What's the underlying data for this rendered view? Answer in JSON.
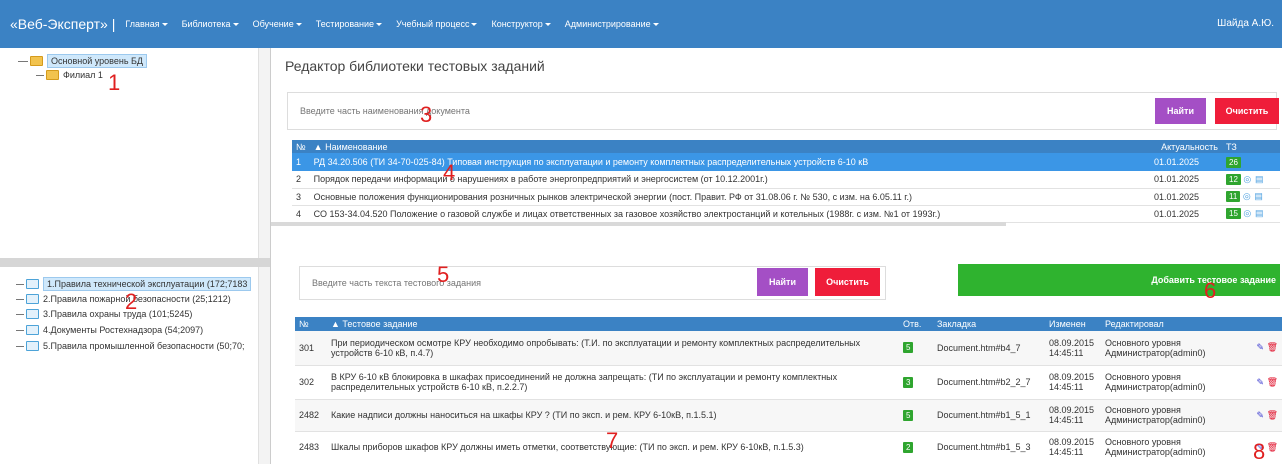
{
  "nav": {
    "brand": "«Веб-Эксперт» |",
    "items": [
      "Главная",
      "Библиотека",
      "Обучение",
      "Тестирование",
      "Учебный процесс",
      "Конструктор",
      "Администрирование"
    ],
    "user": "Шайда А.Ю."
  },
  "tree_top": {
    "root": "Основной уровень БД",
    "child": "Филиал 1"
  },
  "tree_bottom": [
    "1.Правила технической эксплуатации (172;7183",
    "2.Правила пожарной безопасности (25;1212)",
    "3.Правила охраны труда (101;5245)",
    "4.Документы Ростехнадзора (54;2097)",
    "5.Правила промышленной безопасности (50;70;"
  ],
  "main": {
    "title": "Редактор библиотеки тестовых заданий",
    "doc_search_placeholder": "Введите часть наименования документа",
    "find_label": "Найти",
    "clear_label": "Очистить",
    "doc_table": {
      "headers": [
        "№",
        "Наименование",
        "Актуальность",
        "ТЗ"
      ],
      "rows": [
        {
          "n": "1",
          "name": "РД 34.20.506 (ТИ 34-70-025-84) Типовая инструкция по эксплуатации и ремонту комплектных распределительных устройств 6-10 кВ",
          "date": "01.01.2025",
          "count": "26"
        },
        {
          "n": "2",
          "name": "Порядок передачи информации о нарушениях в работе энергопредприятий и энергосистем (от 10.12.2001г.)",
          "date": "01.01.2025",
          "count": "12"
        },
        {
          "n": "3",
          "name": "Основные положения функционирования розничных рынков электрической энергии (пост. Правит. РФ от 31.08.06 г. № 530, с изм. на 6.05.11 г.)",
          "date": "01.01.2025",
          "count": "11"
        },
        {
          "n": "4",
          "name": "СО 153-34.04.520 Положение о газовой службе и лицах ответственных за газовое хозяйство электростанций и котельных (1988г. с изм. №1 от 1993г.)",
          "date": "01.01.2025",
          "count": "15"
        }
      ]
    },
    "task_search_placeholder": "Введите часть текста тестового задания",
    "add_task_label": "Добавить тестовое задание",
    "task_table": {
      "headers": [
        "№",
        "Тестовое задание",
        "Отв.",
        "Закладка",
        "Изменен",
        "Редактировал"
      ],
      "rows": [
        {
          "n": "301",
          "text": "При периодическом осмотре КРУ необходимо опробывать: (Т.И. по эксплуатации и ремонту комплектных распределительных устройств 6-10 кВ, п.4.7)",
          "ans": "5",
          "mark": "Document.htm#b4_7",
          "date": "08.09.2015",
          "time": "14:45:11",
          "ed1": "Основного уровня",
          "ed2": "Администратор(admin0)"
        },
        {
          "n": "302",
          "text": "В КРУ 6-10 кВ блокировка в шкафах присоединений не должна запрещать: (ТИ по эксплуатации и ремонту комплектных распределительных устройств 6-10 кВ, п.2.2.7)",
          "ans": "3",
          "mark": "Document.htm#b2_2_7",
          "date": "08.09.2015",
          "time": "14:45:11",
          "ed1": "Основного уровня",
          "ed2": "Администратор(admin0)"
        },
        {
          "n": "2482",
          "text": "Какие надписи должны наноситься на шкафы КРУ ? (ТИ по эксп. и рем. КРУ 6-10кВ, п.1.5.1)",
          "ans": "5",
          "mark": "Document.htm#b1_5_1",
          "date": "08.09.2015",
          "time": "14:45:11",
          "ed1": "Основного уровня",
          "ed2": "Администратор(admin0)"
        },
        {
          "n": "2483",
          "text": "Шкалы приборов шкафов КРУ должны иметь отметки, соответствующие: (ТИ по эксп. и рем. КРУ 6-10кВ, п.1.5.3)",
          "ans": "2",
          "mark": "Document.htm#b1_5_3",
          "date": "08.09.2015",
          "time": "14:45:11",
          "ed1": "Основного уровня",
          "ed2": "Администратор(admin0)"
        }
      ]
    }
  },
  "markers": [
    "1",
    "2",
    "3",
    "4",
    "5",
    "6",
    "7",
    "8"
  ],
  "colors": {
    "nav": "#3b82c4",
    "purple": "#a44fc5",
    "red": "#ef1d3a",
    "green": "#2fb32f",
    "marker": "#e02020"
  }
}
